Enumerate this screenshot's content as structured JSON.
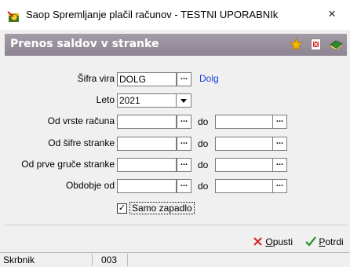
{
  "window": {
    "title": "Saop Spremljanje plačil računov - TESTNI UPORABNIk",
    "close_glyph": "×"
  },
  "header": {
    "title": "Prenos saldov v stranke"
  },
  "form": {
    "sifra_vira": {
      "label": "Šifra vira",
      "value": "DOLG",
      "lookup": "Dolg"
    },
    "leto": {
      "label": "Leto",
      "value": "2021"
    },
    "od_vrste_racuna": {
      "label": "Od vrste računa",
      "from": "",
      "to": ""
    },
    "od_sifre_stranke": {
      "label": "Od šifre stranke",
      "from": "",
      "to": ""
    },
    "od_prve_gruce": {
      "label": "Od prve gruče stranke",
      "from": "",
      "to": ""
    },
    "obdobje": {
      "label": "Obdobje od",
      "from": "",
      "to": ""
    },
    "do_label": "do",
    "dots": "...",
    "samo_zapadlo": {
      "label": "Samo zapadlo",
      "checked": true,
      "check_glyph": "✓"
    }
  },
  "buttons": {
    "opusti_first": "O",
    "opusti_rest": "pusti",
    "potrdi_first": "P",
    "potrdi_rest": "otrdi"
  },
  "status": {
    "user": "Skrbnik",
    "code": "003"
  },
  "icons": [
    "app-icon",
    "star-icon",
    "pdf-icon",
    "book-icon",
    "cancel-x-icon",
    "confirm-check-icon",
    "close-icon",
    "dropdown-arrow-icon"
  ],
  "colors": {
    "header_bg": "#958d99",
    "link": "#1a3fd6",
    "cancel_red": "#d42020",
    "confirm_green": "#1f8f1f"
  }
}
